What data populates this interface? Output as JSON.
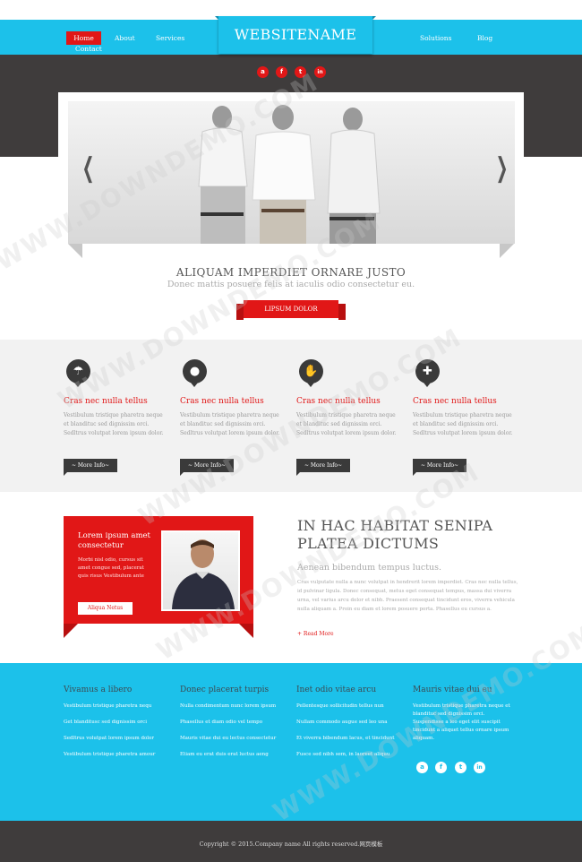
{
  "header": {
    "logo": "WEBSITENAME",
    "nav": {
      "home": "Home",
      "about": "About",
      "services": "Services",
      "contact": "Contact",
      "solutions": "Solutions",
      "blog": "Blog"
    },
    "social": [
      "a",
      "f",
      "t",
      "in"
    ]
  },
  "slider": {
    "prev": "❮",
    "next": "❯"
  },
  "tagline": {
    "title": "ALIQUAM IMPERDIET ORNARE JUSTO",
    "subtitle": "Donec mattis posuere felis at iaculis odio consectetur eu.",
    "button": "LIPSUM DOLOR"
  },
  "features": [
    {
      "icon": "umbrella-icon",
      "glyph": "☂",
      "title": "Cras nec nulla tellus",
      "text": "Vestibulum tristique pharetra neque et blandituc sed dignissim orci. Sedltrus volutpat lorem ipsum dolor.",
      "button": "~ More Info~"
    },
    {
      "icon": "lightbulb-icon",
      "glyph": "●",
      "title": "Cras nec nulla tellus",
      "text": "Vestibulum tristique pharetra neque et blandituc sed dignissim orci. Sedltrus volutpat lorem ipsum dolor.",
      "button": "~ More Info~"
    },
    {
      "icon": "hand-icon",
      "glyph": "✋",
      "title": "Cras nec nulla tellus",
      "text": "Vestibulum tristique pharetra neque et blandituc sed dignissim orci. Sedltrus volutpat lorem ipsum dolor.",
      "button": "~ More Info~"
    },
    {
      "icon": "puzzle-icon",
      "glyph": "✚",
      "title": "Cras nec nulla tellus",
      "text": "Vestibulum tristique pharetra neque et blandituc sed dignissim orci. Sedltrus volutpat lorem ipsum dolor.",
      "button": "~ More Info~"
    }
  ],
  "promo": {
    "card_title": "Lorem ipsum amet consectetur",
    "card_text": "Morbi nisl odio, cursus sit amet congue sed, placerat quis risus Vestibulum ante",
    "card_button": "Aliqua Netus",
    "title": "IN HAC HABITAT SENIPA PLATEA DICTUMS",
    "subtitle": "Aenean bibendum tempus luctus.",
    "paragraph": "Cras vulputate nulla a nunc volutpat in hendrerit lorem imperdiet. Cras nec nulla tellus, id pulvinar ligula. Donec consequat, metus eget consequat tempus, massa dui viverra urna, vel varius arcu dolor et nibh. Praesent consequat tincidunt eros, viverra vehicula nulla aliquam a. Proin eu diam et lorem posuere porta. Phasellus eu cursus a.",
    "read_more": "+ Read More"
  },
  "footer": {
    "columns": [
      {
        "title": "Vivamus a libero",
        "links": [
          "Vestibulum tristique pharetra nequ",
          "Get blanditusc sed dignissim orci",
          "Sedltrus volutpat lorem ipsum dolor",
          "Vestibulum tristique pharetra amour"
        ]
      },
      {
        "title": "Donec placerat turpis",
        "links": [
          "Nulla condimentum nunc lorem ipsum",
          "Phasellus et diam odio vel tempo",
          "Mauris vitae dui eu lectus consectetur",
          "Etiam eu erat duis erat luctus aeng"
        ]
      },
      {
        "title": "Inet odio vitae arcu",
        "links": [
          "Pellentesque sollicitudin tellus nun",
          "Nullam commodo augue sed leo una",
          "Et viverra bibendum lacus, et tincidunt",
          "Fusce sed nibh sem, in laoreet aliquu"
        ]
      }
    ],
    "col4": {
      "title": "Mauris vitae dui eu",
      "text": "Vestibulum tristique pharetra neque et blandituc sed dignissim orci. Suspendisse a leo eget elit suscipit tincidunt a aliquet tellus ornare ipsum aliquam."
    },
    "social": [
      "a",
      "f",
      "t",
      "in"
    ],
    "copyright": "Copyright © 2015.Company name All rights reserved.网页模板"
  },
  "watermark": "WWW.DOWNDEMO.COM",
  "colors": {
    "accent": "#1cc1ea",
    "red": "#e11717",
    "dark": "#3f3c3c"
  }
}
